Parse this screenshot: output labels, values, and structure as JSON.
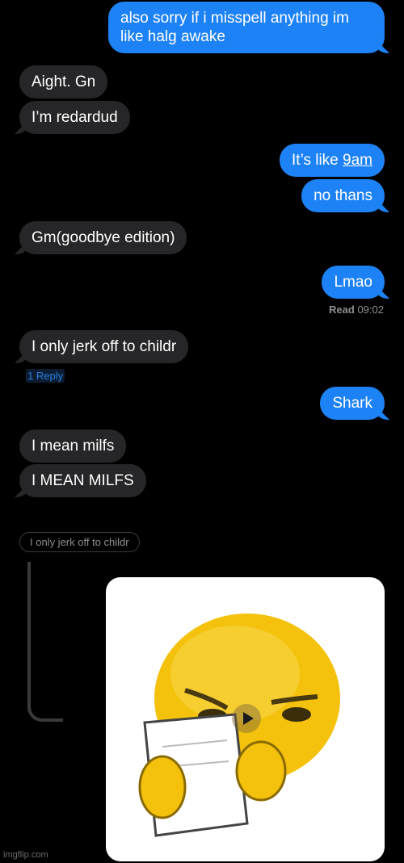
{
  "messages": {
    "m1": "also sorry if i misspell anything im like halg awake",
    "m2": "Aight. Gn",
    "m3": "I’m redardud",
    "m4_prefix": "It’s like ",
    "m4_link": "9am",
    "m5": "no thans",
    "m6": "Gm(goodbye edition)",
    "m7": "Lmao",
    "m8": "I only jerk off to childr",
    "m9": "Shark",
    "m10": "I mean milfs",
    "m11": "I MEAN MILFS"
  },
  "receipt": {
    "label": "Read",
    "time": "09:02"
  },
  "reply_link": "1 Reply",
  "quoted_reply": "I only jerk off to childr",
  "media": {
    "icon": "play-icon",
    "type": "gif"
  },
  "watermark": "imgflip.com",
  "colors": {
    "sent": "#1d82f5",
    "received": "#262628",
    "background": "#000000"
  }
}
